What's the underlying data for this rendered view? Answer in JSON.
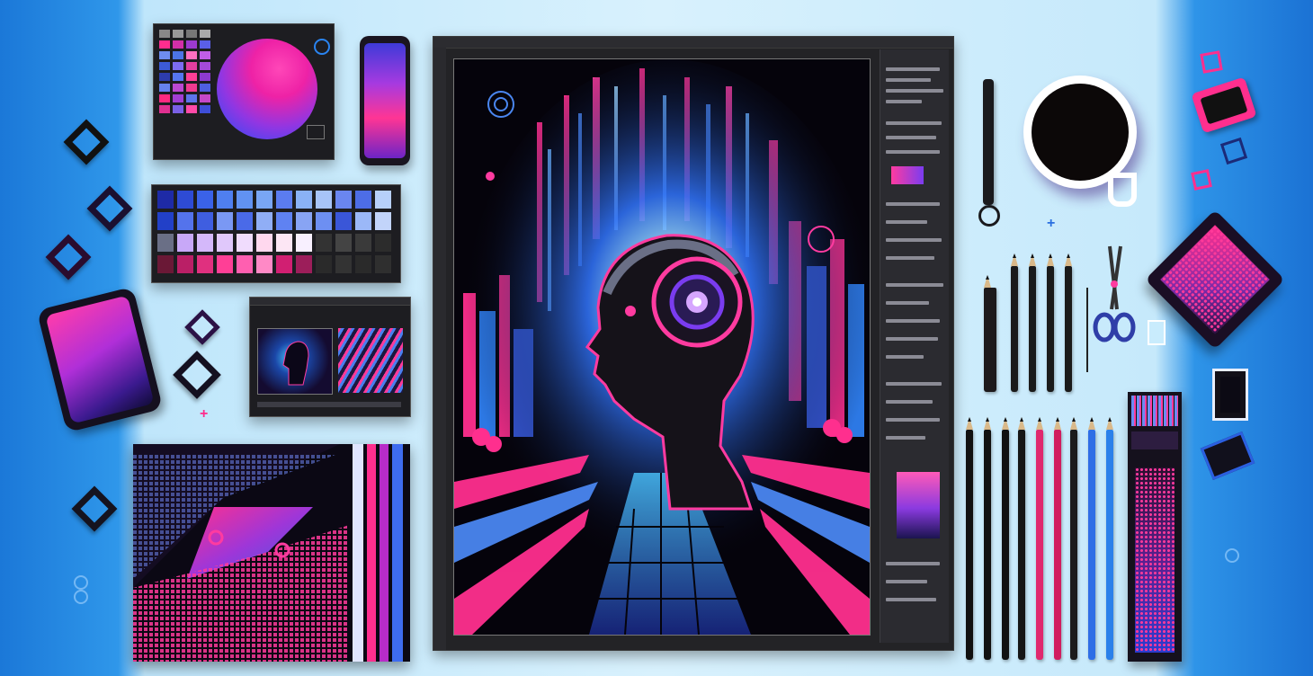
{
  "scene": {
    "description_free": true,
    "colors": {
      "background_left": "#1b78d8",
      "background_center": "#d8f1fd",
      "magenta": "#ff1e8a",
      "purple": "#7a3cf0",
      "blue": "#2f7ff0",
      "panel_dark": "#1d1d21"
    },
    "icons": [
      "color-picker-panel",
      "smartphone",
      "swatch-palette",
      "thumbnail-window",
      "gradient-artboard",
      "editor-window",
      "cyborg-head-artwork",
      "coffee-mug",
      "stylus",
      "pencils",
      "scissors",
      "gradient-card",
      "color-strip"
    ]
  }
}
